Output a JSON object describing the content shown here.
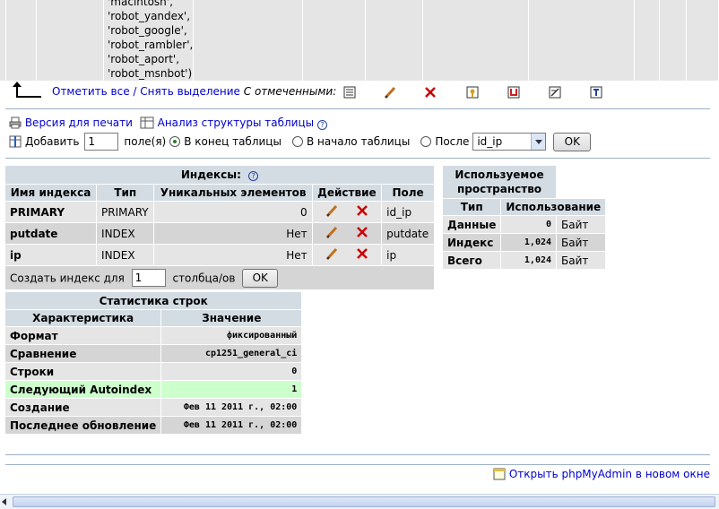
{
  "enum_values": [
    "'macintosh',",
    "'robot_yandex',",
    "'robot_google',",
    "'robot_rambler',",
    "'robot_aport',",
    "'robot_msnbot')"
  ],
  "actions": {
    "check_all": "Отметить все",
    "separator": "/",
    "uncheck_all": "Снять выделение",
    "with_selected": "С отмеченными:"
  },
  "links": {
    "print_view": "Версия для печати",
    "analyze": "Анализ структуры таблицы"
  },
  "add_field": {
    "label": "Добавить",
    "count": "1",
    "fields_label": "поле(я)",
    "opt_end": "В конец таблицы",
    "opt_begin": "В начало таблицы",
    "opt_after": "После",
    "after_select": "id_ip",
    "ok": "OK"
  },
  "indexes": {
    "title": "Индексы:",
    "headers": [
      "Имя индекса",
      "Тип",
      "Уникальных элементов",
      "Действие",
      "Поле"
    ],
    "rows": [
      {
        "name": "PRIMARY",
        "type": "PRIMARY",
        "cardinality": "0",
        "field": "id_ip"
      },
      {
        "name": "putdate",
        "type": "INDEX",
        "cardinality": "Нет",
        "field": "putdate"
      },
      {
        "name": "ip",
        "type": "INDEX",
        "cardinality": "Нет",
        "field": "ip"
      }
    ],
    "create_label": "Создать индекс для",
    "create_count": "1",
    "create_suffix": "столбца/ов",
    "ok": "OK"
  },
  "space": {
    "title_line1": "Используемое",
    "title_line2": "пространство",
    "headers": [
      "Тип",
      "Использование"
    ],
    "rows": [
      {
        "type": "Данные",
        "value": "0",
        "unit": "Байт"
      },
      {
        "type": "Индекс",
        "value": "1,024",
        "unit": "Байт"
      },
      {
        "type": "Всего",
        "value": "1,024",
        "unit": "Байт"
      }
    ]
  },
  "row_stats": {
    "title": "Статистика строк",
    "headers": [
      "Характеристика",
      "Значение"
    ],
    "rows": [
      {
        "name": "Формат",
        "value": "фиксированный"
      },
      {
        "name": "Сравнение",
        "value": "cp1251_general_ci"
      },
      {
        "name": "Строки",
        "value": "0"
      },
      {
        "name": "Следующий Autoindex",
        "value": "1"
      },
      {
        "name": "Создание",
        "value": "Фев 11 2011 г., 02:00"
      },
      {
        "name": "Последнее обновление",
        "value": "Фев 11 2011 г., 02:00"
      }
    ]
  },
  "footer": {
    "open_new_window": "Открыть phpMyAdmin в новом окне"
  }
}
